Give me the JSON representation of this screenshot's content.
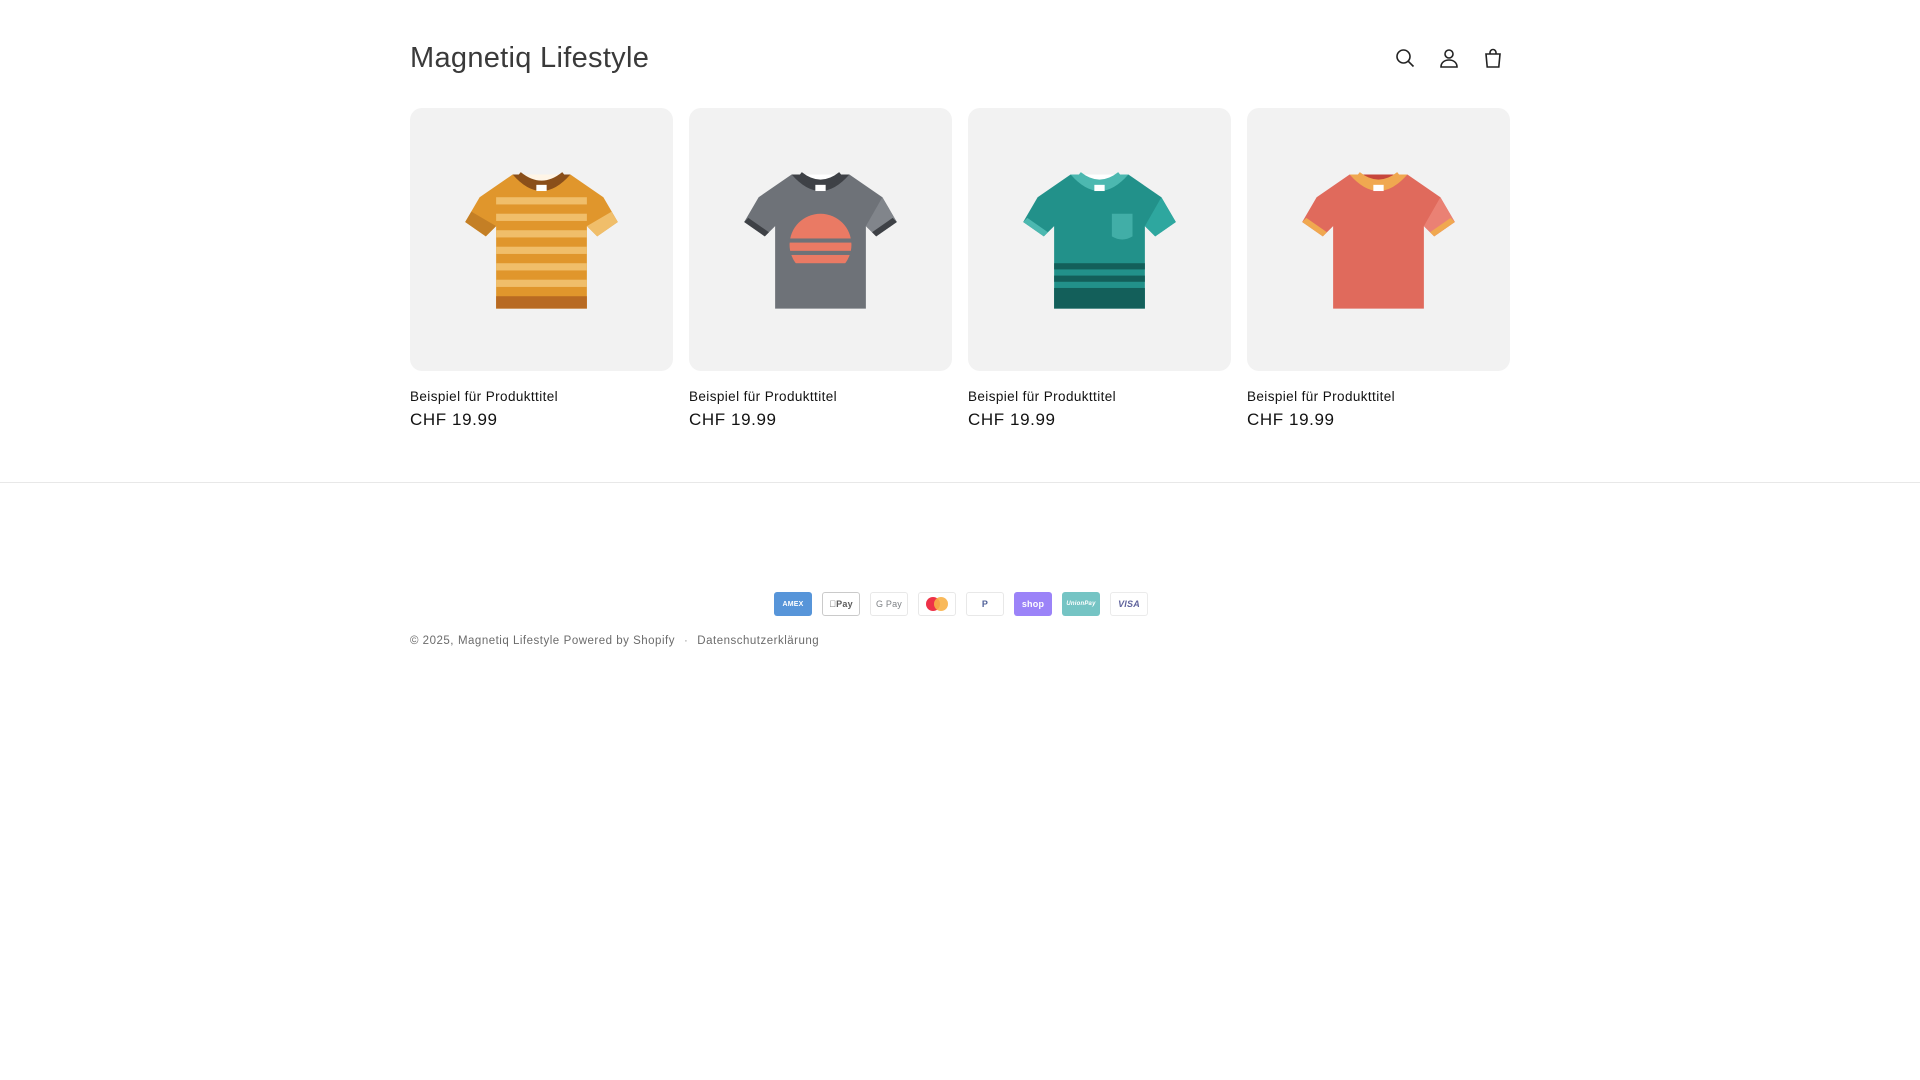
{
  "header": {
    "logo": "Magnetiq Lifestyle",
    "icons": [
      "search-icon",
      "account-icon",
      "cart-icon"
    ]
  },
  "products": [
    {
      "title": "Beispiel für Produkttitel",
      "price": "CHF 19.99",
      "image": "striped-orange-tshirt",
      "color": "#e2a03b"
    },
    {
      "title": "Beispiel für Produkttitel",
      "price": "CHF 19.99",
      "image": "grey-sunset-tshirt",
      "color": "#6d7177"
    },
    {
      "title": "Beispiel für Produkttitel",
      "price": "CHF 19.99",
      "image": "teal-pocket-tshirt",
      "color": "#24928a"
    },
    {
      "title": "Beispiel für Produkttitel",
      "price": "CHF 19.99",
      "image": "red-ringer-tshirt",
      "color": "#e36a5c"
    }
  ],
  "footer": {
    "payments": [
      "AMEX",
      "Pay",
      "G Pay",
      "mastercard",
      "P",
      "shop",
      "UnionPay",
      "VISA"
    ],
    "copyright_prefix": "© 2025,",
    "store_link": "Magnetiq Lifestyle",
    "powered_by": "Powered by Shopify",
    "privacy_link": "Datenschutzerklärung",
    "separator": "·"
  }
}
